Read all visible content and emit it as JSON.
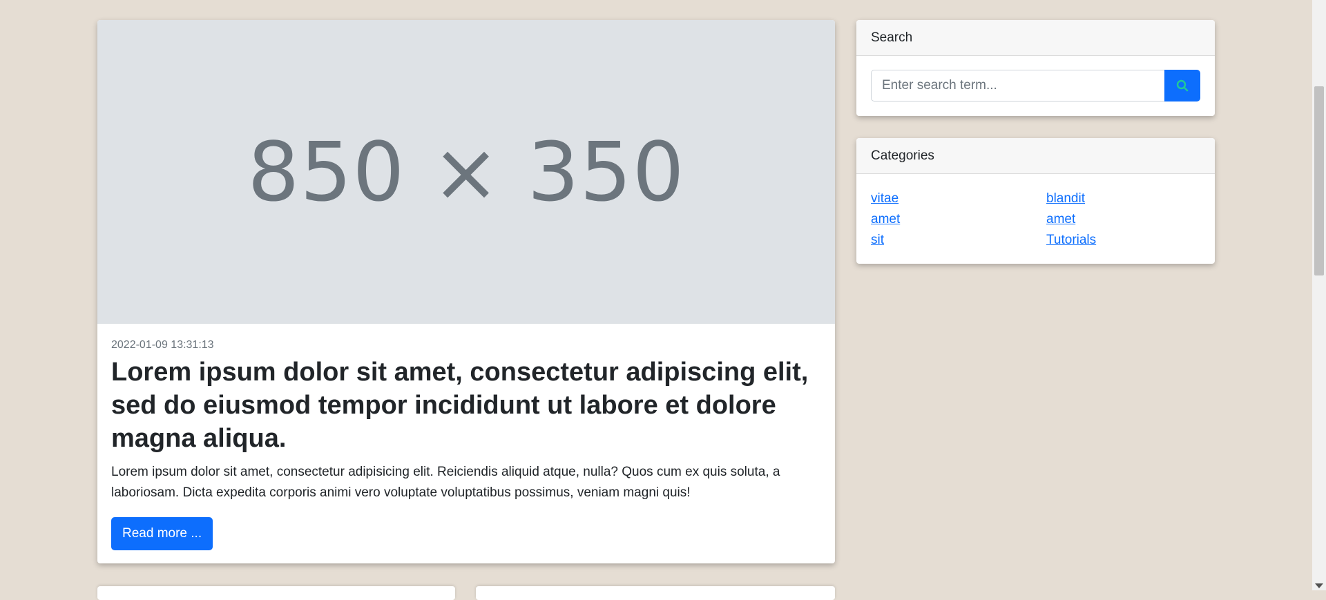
{
  "post": {
    "image_placeholder": "850 × 350",
    "date": "2022-01-09 13:31:13",
    "title": "Lorem ipsum dolor sit amet, consectetur adipiscing elit, sed do eiusmod tempor incididunt ut labore et dolore magna aliqua.",
    "excerpt": "Lorem ipsum dolor sit amet, consectetur adipisicing elit. Reiciendis aliquid atque, nulla? Quos cum ex quis soluta, a laboriosam. Dicta expedita corporis animi vero voluptate voluptatibus possimus, veniam magni quis!",
    "read_more_label": "Read more ..."
  },
  "search": {
    "header": "Search",
    "placeholder": "Enter search term...",
    "value": "",
    "button_icon": "search-icon"
  },
  "categories": {
    "header": "Categories",
    "items": [
      "vitae",
      "blandit",
      "amet",
      "amet",
      "sit",
      "Tutorials"
    ]
  },
  "colors": {
    "background": "#e5ddd3",
    "primary": "#0d6efd",
    "placeholder_bg": "#dee2e6",
    "muted_text": "#6c757d"
  }
}
